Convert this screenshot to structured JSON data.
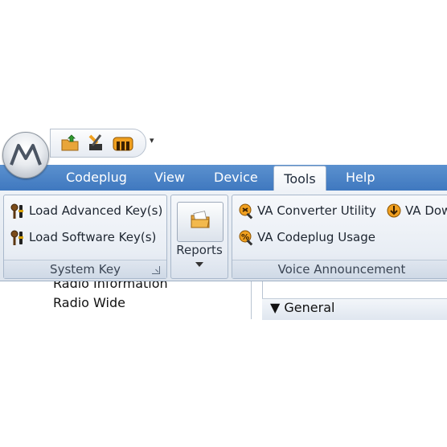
{
  "window": {
    "quick_access": {
      "items": [
        "open-folder-icon",
        "tools-icon",
        "device-icon"
      ],
      "customize_label": "▾"
    }
  },
  "ribbon": {
    "tabs": [
      {
        "label": "Codeplug"
      },
      {
        "label": "View"
      },
      {
        "label": "Device"
      },
      {
        "label": "Tools",
        "active": true
      },
      {
        "label": "Help"
      }
    ],
    "groups": {
      "system_key": {
        "label": "System Key",
        "load_advanced": "Load Advanced Key(s)",
        "load_software": "Load Software Key(s)"
      },
      "reports": {
        "label": "Reports"
      },
      "voice_announcement": {
        "label": "Voice Announcement",
        "va_converter": "VA Converter Utility",
        "va_download": "VA Dow",
        "va_codeplug_usage": "VA Codeplug Usage"
      }
    }
  },
  "tree": {
    "items": [
      "Radio Information",
      "Radio Wide"
    ]
  },
  "panel": {
    "section": "▼ General"
  },
  "colors": {
    "tab_bar": "#4a84c8",
    "ribbon_bg": "#e6ebf2"
  }
}
